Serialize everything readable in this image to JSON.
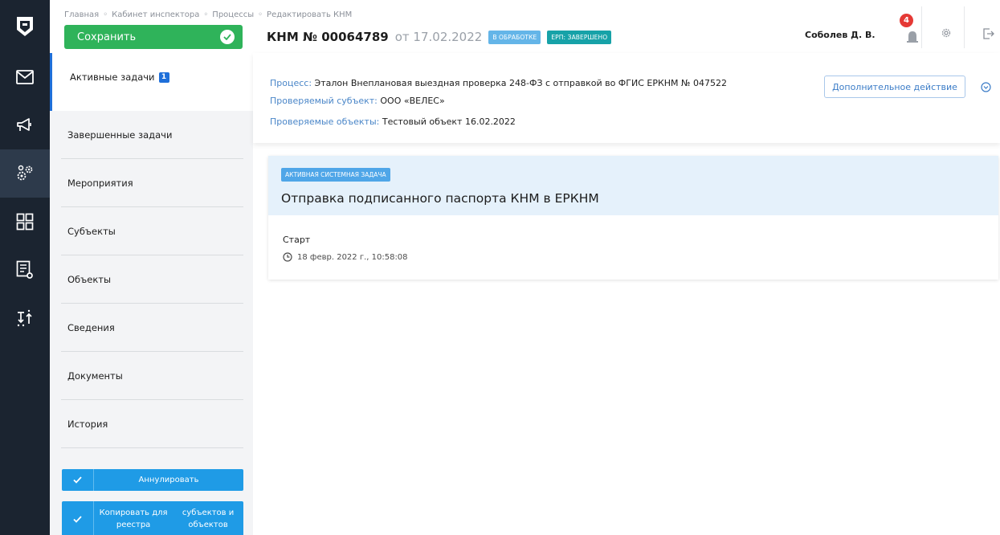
{
  "header": {
    "breadcrumbs": [
      "Главная",
      "Кабинет инспектора",
      "Процессы",
      "Редактировать КНМ"
    ],
    "save_label": "Сохранить",
    "knm_number": "КНМ № 00064789",
    "knm_date": "от 17.02.2022",
    "status_badge": "В ОБРАБОТКЕ",
    "erp_badge": "ЕРП: ЗАВЕРШЕНО",
    "user_name": "Соболев Д. В.",
    "notification_count": "4"
  },
  "rail": {
    "icons": [
      "logo-icon",
      "mail-icon",
      "megaphone-icon",
      "settings-gears-icon",
      "dashboard-icon",
      "registry-icon",
      "sort-icon"
    ],
    "active": "settings-gears-icon"
  },
  "sidebar": {
    "items": [
      {
        "label": "Активные задачи",
        "count": "1"
      },
      {
        "label": "Завершенные задачи"
      },
      {
        "label": "Мероприятия"
      },
      {
        "label": "Субъекты"
      },
      {
        "label": "Объекты"
      },
      {
        "label": "Сведения"
      },
      {
        "label": "Документы"
      },
      {
        "label": "История"
      }
    ],
    "cancel_label": "Аннулировать",
    "copy_label_1": "Копировать для реестра",
    "copy_label_2": "субъектов и объектов"
  },
  "info": {
    "process_key": "Процесс:",
    "process_value": "Эталон Внеплановая выездная проверка 248-ФЗ с отправкой во ФГИС ЕРКНМ № 047522",
    "subject_key": "Проверяемый субъект:",
    "subject_value": "ООО «ВЕЛЕС»",
    "objects_key": "Проверяемые объекты:",
    "objects_value": "Тестовый объект 16.02.2022",
    "extra_action_label": "Дополнительное действие"
  },
  "task": {
    "badge": "АКТИВНАЯ СИСТЕМНАЯ ЗАДАЧА",
    "title": "Отправка подписанного паспорта КНМ в ЕРКНМ",
    "start_label": "Старт",
    "start_time": "18 февр. 2022 г., 10:58:08"
  },
  "colors": {
    "rail_bg": "#1b2430",
    "save_green": "#2fb35a",
    "accent_blue": "#1e6fd9",
    "badge_teal": "#17a2a8",
    "task_header_bg": "#e5f1fb",
    "sidebar_button": "#1f9be6",
    "notification_red": "#e53935"
  }
}
